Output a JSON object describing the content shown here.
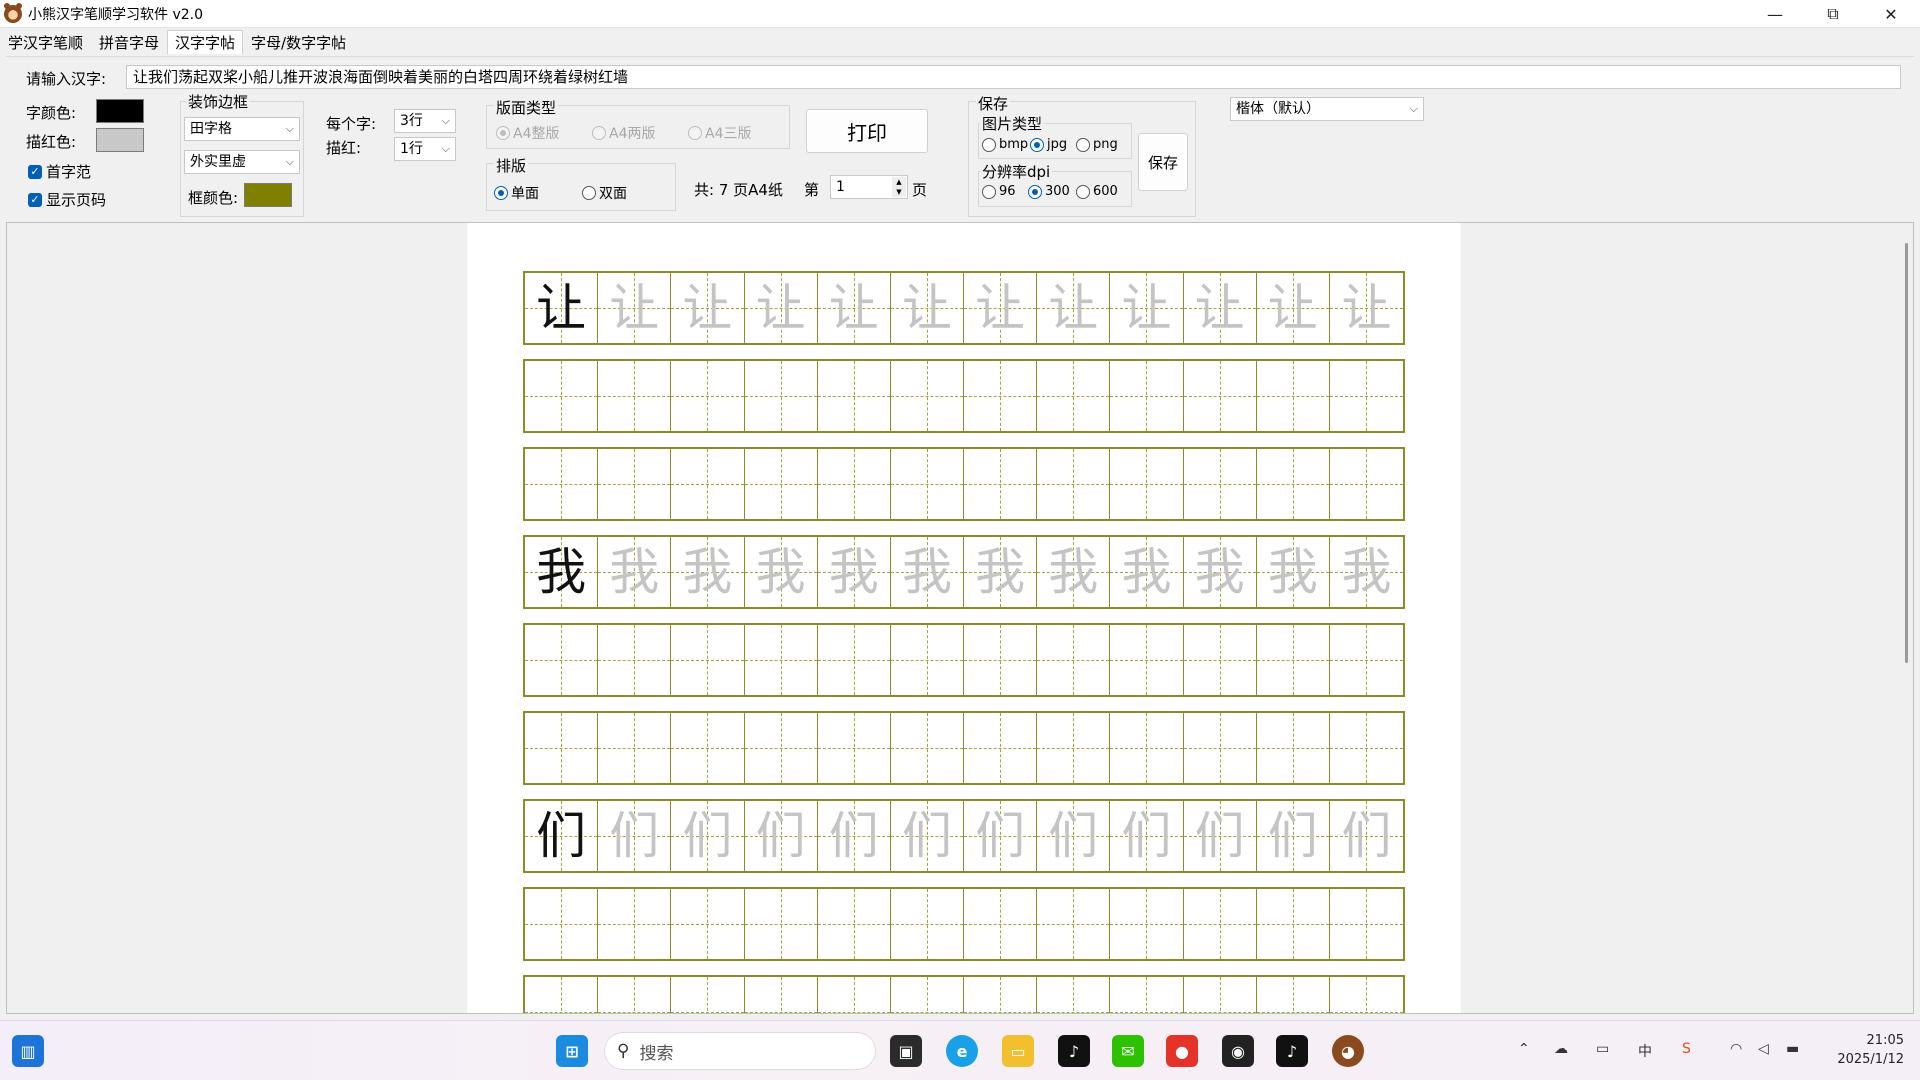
{
  "window": {
    "title": "小熊汉字笔顺学习软件 v2.0",
    "minimize": "—",
    "restore": "⧉",
    "close": "✕"
  },
  "tabs": [
    {
      "label": "学汉字笔顺"
    },
    {
      "label": "拼音字母"
    },
    {
      "label": "汉字字帖",
      "active": true
    },
    {
      "label": "字母/数字字帖"
    }
  ],
  "controls": {
    "input_label": "请输入汉字:",
    "input_value": "让我们荡起双桨小船儿推开波浪海面倒映着美丽的白塔四周环绕着绿树红墙",
    "font_color_label": "字颜色:",
    "font_color": "#000000",
    "trace_color_label": "描红色:",
    "trace_color": "#c8c8c8",
    "first_model_label": "首字范",
    "first_model_checked": true,
    "show_page_label": "显示页码",
    "show_page_checked": true,
    "border_group_title": "装饰边框",
    "grid_type": "田字格",
    "border_style": "外实里虚",
    "frame_color_label": "框颜色:",
    "frame_color": "#808000",
    "rows_per_char_label": "每个字:",
    "rows_per_char": "3行",
    "trace_rows_label": "描红:",
    "trace_rows": "1行",
    "layout_type_title": "版面类型",
    "layout_types": [
      {
        "label": "A4整版",
        "selected": true
      },
      {
        "label": "A4两版",
        "selected": false
      },
      {
        "label": "A4三版",
        "selected": false
      }
    ],
    "print_label": "打印",
    "arrange_title": "排版",
    "arrange_options": [
      {
        "label": "单面",
        "selected": true
      },
      {
        "label": "双面",
        "selected": false
      }
    ],
    "total_text": "共: 7 页A4纸",
    "page_prefix": "第",
    "page_value": "1",
    "page_suffix": "页",
    "save_group_title": "保存",
    "image_type_title": "图片类型",
    "image_types": [
      {
        "label": "bmp",
        "selected": false
      },
      {
        "label": "jpg",
        "selected": true
      },
      {
        "label": "png",
        "selected": false
      }
    ],
    "dpi_title": "分辨率dpi",
    "dpi_options": [
      {
        "label": "96",
        "selected": false
      },
      {
        "label": "300",
        "selected": true
      },
      {
        "label": "600",
        "selected": false
      }
    ],
    "save_label": "保存",
    "font_select": "楷体（默认）"
  },
  "sheet": {
    "columns": 12,
    "rows": [
      {
        "char": "让",
        "mode": "model+trace"
      },
      {
        "char": "",
        "mode": "empty"
      },
      {
        "char": "",
        "mode": "empty"
      },
      {
        "char": "我",
        "mode": "model+trace"
      },
      {
        "char": "",
        "mode": "empty"
      },
      {
        "char": "",
        "mode": "empty"
      },
      {
        "char": "们",
        "mode": "model+trace"
      },
      {
        "char": "",
        "mode": "empty"
      },
      {
        "char": "",
        "mode": "empty"
      }
    ]
  },
  "taskbar": {
    "search_placeholder": "搜索",
    "time": "21:05",
    "date": "2025/1/12",
    "apps": [
      "start-icon",
      "task-view-icon",
      "edge-icon",
      "file-explorer-icon",
      "tiktok-icon",
      "wechat-icon",
      "weibo-icon",
      "qq-icon",
      "tiktok-icon",
      "bear-app-icon"
    ]
  }
}
